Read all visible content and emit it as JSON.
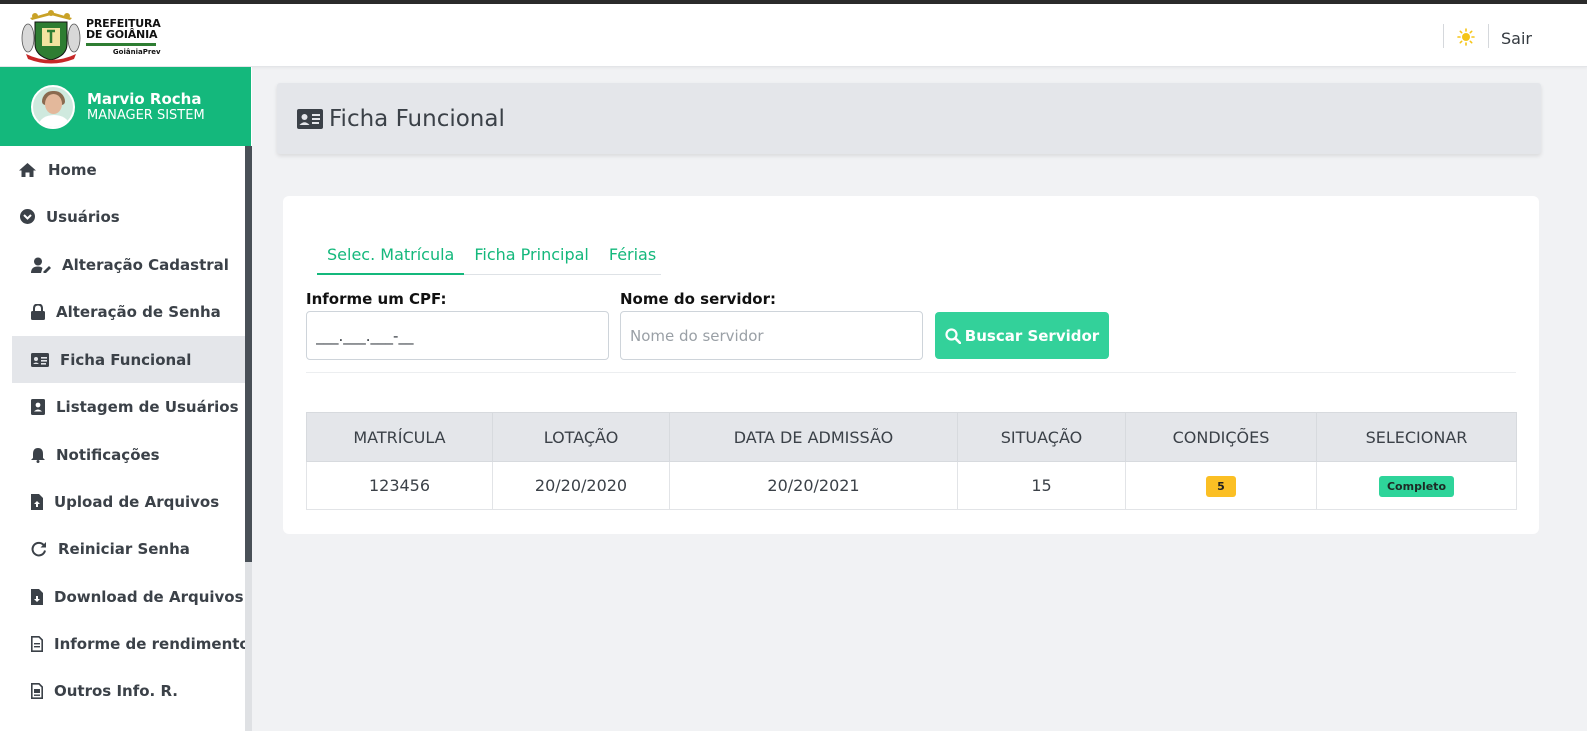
{
  "header": {
    "logo": {
      "line1": "PREFEITURA",
      "line2": "DE GOIÂNIA",
      "line3": "GoiâniaPrev"
    },
    "logout_label": "Sair"
  },
  "sidebar": {
    "user": {
      "name": "Marvio Rocha",
      "role": "MANAGER SISTEM"
    },
    "items": [
      {
        "label": "Home",
        "icon": "home-icon"
      },
      {
        "label": "Usuários",
        "icon": "chevron-circle-down-icon"
      },
      {
        "label": "Alteração Cadastral",
        "icon": "user-edit-icon"
      },
      {
        "label": "Alteração de Senha",
        "icon": "lock-icon"
      },
      {
        "label": "Ficha Funcional",
        "icon": "id-card-icon"
      },
      {
        "label": "Listagem de Usuários",
        "icon": "address-book-icon"
      },
      {
        "label": "Notificações",
        "icon": "bell-icon"
      },
      {
        "label": "Upload de Arquivos",
        "icon": "file-upload-icon"
      },
      {
        "label": "Reiniciar Senha",
        "icon": "redo-icon"
      },
      {
        "label": "Download de Arquivos",
        "icon": "file-download-icon"
      },
      {
        "label": "Informe de rendimento",
        "icon": "file-alt-icon"
      },
      {
        "label": "Outros Info. R.",
        "icon": "file-invoice-icon"
      }
    ],
    "active_item": "Ficha Funcional"
  },
  "page": {
    "title": "Ficha Funcional"
  },
  "tabs": [
    {
      "label": "Selec. Matrícula",
      "active": true
    },
    {
      "label": "Ficha Principal",
      "active": false
    },
    {
      "label": "Férias",
      "active": false
    }
  ],
  "form": {
    "cpf_label": "Informe um CPF:",
    "cpf_value": "___.___.___-__",
    "name_label": "Nome do servidor:",
    "name_placeholder": "Nome do servidor",
    "search_button": "Buscar Servidor"
  },
  "table": {
    "columns": [
      "MATRÍCULA",
      "LOTAÇÃO",
      "DATA DE ADMISSÃO",
      "SITUAÇÃO",
      "CONDIÇÕES",
      "SELECIONAR"
    ],
    "rows": [
      {
        "matricula": "123456",
        "lotacao": "20/20/2020",
        "admissao": "20/20/2021",
        "situacao": "15",
        "condicoes": "5",
        "selecionar": "Completo"
      }
    ]
  },
  "colors": {
    "accent": "#14b87c",
    "button": "#33d19a",
    "warning_badge": "#fbbf24",
    "success_badge": "#2ed49a"
  }
}
